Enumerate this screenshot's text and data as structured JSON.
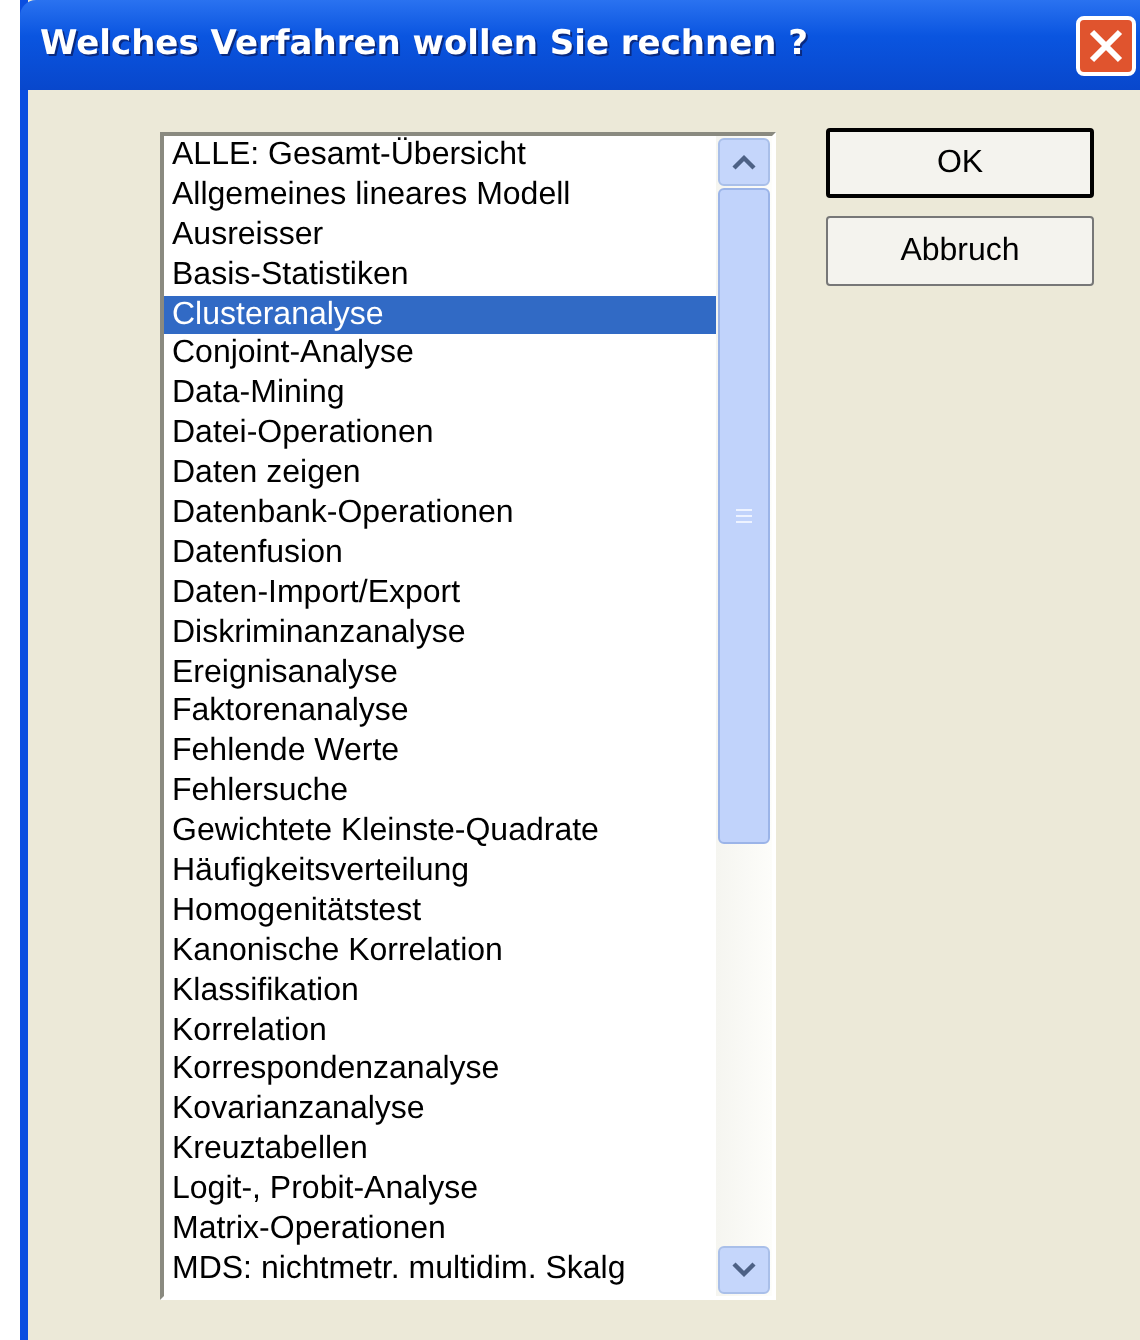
{
  "window": {
    "title": "Welches Verfahren wollen Sie rechnen ?"
  },
  "list": {
    "items": [
      {
        "label": "ALLE: Gesamt-Übersicht",
        "selected": false
      },
      {
        "label": "Allgemeines lineares Modell",
        "selected": false
      },
      {
        "label": "Ausreisser",
        "selected": false
      },
      {
        "label": "Basis-Statistiken",
        "selected": false
      },
      {
        "label": "Clusteranalyse",
        "selected": true
      },
      {
        "label": "Conjoint-Analyse",
        "selected": false
      },
      {
        "label": "Data-Mining",
        "selected": false
      },
      {
        "label": "Datei-Operationen",
        "selected": false
      },
      {
        "label": "Daten zeigen",
        "selected": false
      },
      {
        "label": "Datenbank-Operationen",
        "selected": false
      },
      {
        "label": "Datenfusion",
        "selected": false
      },
      {
        "label": "Daten-Import/Export",
        "selected": false
      },
      {
        "label": "Diskriminanzanalyse",
        "selected": false
      },
      {
        "label": "Ereignisanalyse",
        "selected": false
      },
      {
        "label": "Faktorenanalyse",
        "selected": false
      },
      {
        "label": "Fehlende Werte",
        "selected": false
      },
      {
        "label": "Fehlersuche",
        "selected": false
      },
      {
        "label": "Gewichtete Kleinste-Quadrate",
        "selected": false
      },
      {
        "label": "Häufigkeitsverteilung",
        "selected": false
      },
      {
        "label": "Homogenitätstest",
        "selected": false
      },
      {
        "label": "Kanonische Korrelation",
        "selected": false
      },
      {
        "label": "Klassifikation",
        "selected": false
      },
      {
        "label": "Korrelation",
        "selected": false
      },
      {
        "label": "Korrespondenzanalyse",
        "selected": false
      },
      {
        "label": "Kovarianzanalyse",
        "selected": false
      },
      {
        "label": "Kreuztabellen",
        "selected": false
      },
      {
        "label": "Logit-, Probit-Analyse",
        "selected": false
      },
      {
        "label": "Matrix-Operationen",
        "selected": false
      },
      {
        "label": "MDS: nichtmetr. multidim. Skalg",
        "selected": false
      }
    ]
  },
  "buttons": [
    {
      "label": "OK",
      "default": true
    },
    {
      "label": "Abbruch",
      "default": false
    }
  ]
}
